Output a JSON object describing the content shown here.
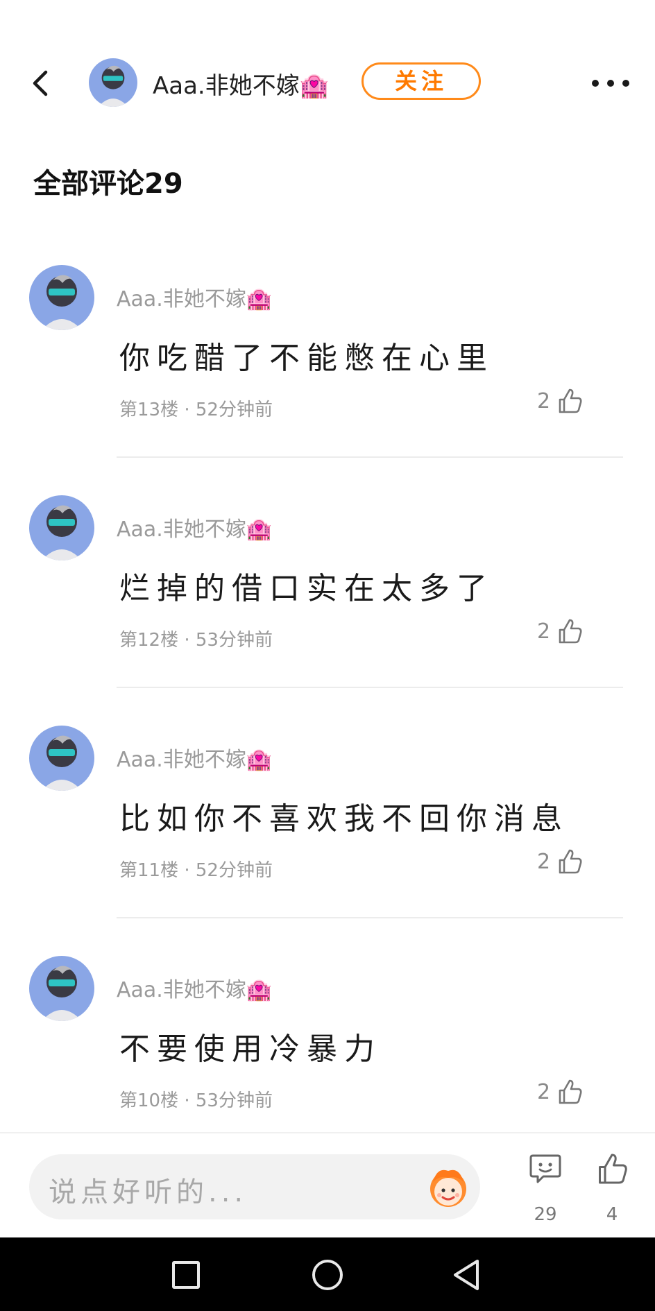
{
  "header": {
    "username": "Aaa.非她不嫁🏩",
    "follow_label": "关注"
  },
  "comments_title": "全部评论29",
  "comments": [
    {
      "username": "Aaa.非她不嫁🏩",
      "text": "你吃醋了不能憋在心里",
      "floor_time": "第13楼 · 52分钟前",
      "likes": "2"
    },
    {
      "username": "Aaa.非她不嫁🏩",
      "text": "烂掉的借口实在太多了",
      "floor_time": "第12楼 · 53分钟前",
      "likes": "2"
    },
    {
      "username": "Aaa.非她不嫁🏩",
      "text": "比如你不喜欢我不回你消息",
      "floor_time": "第11楼 · 52分钟前",
      "likes": "2"
    },
    {
      "username": "Aaa.非她不嫁🏩",
      "text": "不要使用冷暴力",
      "floor_time": "第10楼 · 53分钟前",
      "likes": "2"
    }
  ],
  "bottom_bar": {
    "input_placeholder": "说点好听的...",
    "comment_count": "29",
    "like_count": "4"
  },
  "colors": {
    "accent": "#ff7a00",
    "muted_text": "#9a9a9a",
    "avatar_bg": "#8aa6e6"
  },
  "icons": {
    "back": "chevron-left-icon",
    "more": "more-dots-icon",
    "like": "thumbs-up-icon",
    "comment": "comment-bubble-icon",
    "emoji": "emoji-face-icon",
    "nav_recents": "square-icon",
    "nav_home": "circle-icon",
    "nav_back": "triangle-back-icon"
  }
}
